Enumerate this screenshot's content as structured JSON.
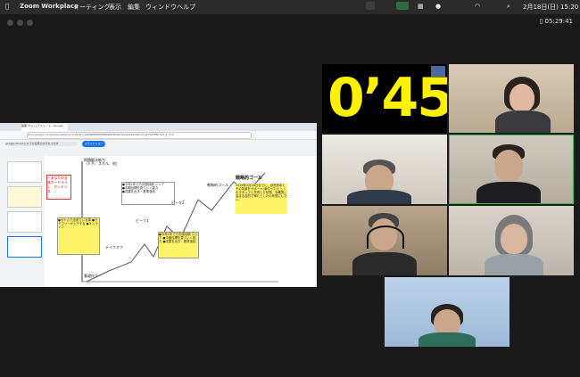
{
  "menubar": {
    "app": "Zoom Workplace",
    "items": [
      "ミーティング",
      "表示",
      "編集",
      "ウィンドウ",
      "ヘルプ"
    ],
    "clock": "2月18日(日) 15:20"
  },
  "meeting": {
    "elapsed": "05:29:41"
  },
  "browser": {
    "tab_title": "長期プロジェクトシート - Google",
    "url": "docs.google.com/presentation/d/1rS4vtJ7_XzD86f0P8QNNO0bZ3KiGXdQ/edit#slide=id.g27b27f5b7e3_0_133",
    "search_chip": "google.drivenに以下の任意の文字をさがす",
    "button": "スライドショー"
  },
  "slide": {
    "left_note": "・あなたの全体ボードライン、センテンス",
    "label_top": "問題解決能力\n（人手、スキル、他）",
    "label_peak1": "ピーク1",
    "label_peak2": "ピーク2",
    "label_takeoff": "テイクオフ",
    "label_base": "基礎作り",
    "label_goal": "戦略的ゴール",
    "box1": "●今年1年で方向感持続 シリア\n●中期目標を見ていく能力\n●成果を出す・基準強化",
    "box2": "●ボトムで出来ている事\n●カテゴリーが上下する\n●オンライン",
    "goal_title": "戦略的ゴール",
    "goal_text": "2026年2月18日までに、自然資本とその背景をサポート(添付って)としくのスタッフと共有した状態。効果的に高まる目的で得たとしたの状態にしたい。"
  },
  "timer_tile": {
    "text": "0’45"
  },
  "participants": [
    {
      "label": "participant-woman-top"
    },
    {
      "label": "participant-man-cap"
    },
    {
      "label": "participant-man-smiling"
    },
    {
      "label": "participant-man-headset"
    },
    {
      "label": "participant-woman-older"
    },
    {
      "label": "participant-woman-bottom"
    }
  ]
}
